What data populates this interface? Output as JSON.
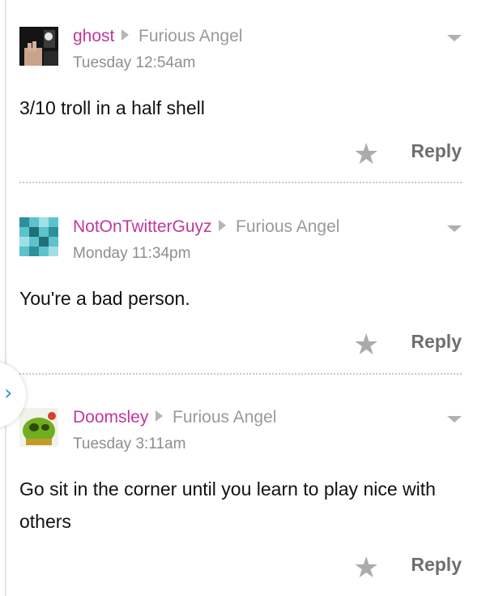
{
  "comments": [
    {
      "author": "ghost",
      "reply_to": "Furious Angel",
      "time": "Tuesday 12:54am",
      "body": "3/10 troll in a half shell",
      "reply_label": "Reply",
      "avatar_icon": "avatar-dark-character-icon"
    },
    {
      "author": "NotOnTwitterGuyz",
      "reply_to": "Furious Angel",
      "time": "Monday 11:34pm",
      "body": "You're a bad person.",
      "reply_label": "Reply",
      "avatar_icon": "avatar-teal-pattern-icon"
    },
    {
      "author": "Doomsley",
      "reply_to": "Furious Angel",
      "time": "Tuesday 3:11am",
      "body": "Go sit in the corner until you learn to play nice with others",
      "reply_label": "Reply",
      "avatar_icon": "avatar-green-monster-icon"
    }
  ],
  "colors": {
    "author": "#c0389b",
    "meta": "#9a9a9a",
    "accent": "#2d9dc5"
  }
}
